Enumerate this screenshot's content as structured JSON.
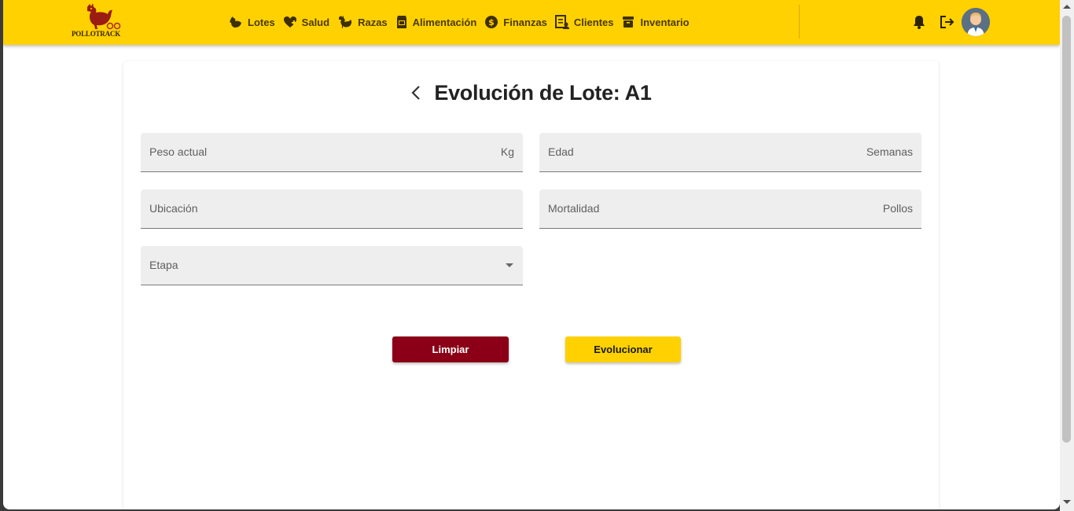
{
  "app": {
    "logo_text": "POLLOTRACK",
    "brand_color": "#ffd100",
    "accent_red": "#8b0016"
  },
  "nav": {
    "items": [
      {
        "label": "Lotes",
        "icon": "chicken-icon"
      },
      {
        "label": "Salud",
        "icon": "health-heart-icon"
      },
      {
        "label": "Razas",
        "icon": "rooster-icon"
      },
      {
        "label": "Alimentación",
        "icon": "feed-bag-icon"
      },
      {
        "label": "Finanzas",
        "icon": "dollar-icon"
      },
      {
        "label": "Clientes",
        "icon": "clients-list-icon"
      },
      {
        "label": "Inventario",
        "icon": "inventory-box-icon"
      }
    ]
  },
  "header_actions": {
    "notifications_icon": "bell-icon",
    "logout_icon": "logout-icon",
    "avatar_icon": "user-avatar"
  },
  "page": {
    "title": "Evolución de Lote: A1"
  },
  "form": {
    "peso": {
      "label": "Peso actual",
      "suffix": "Kg",
      "value": ""
    },
    "edad": {
      "label": "Edad",
      "suffix": "Semanas",
      "value": ""
    },
    "ubicacion": {
      "label": "Ubicación",
      "value": ""
    },
    "mortalidad": {
      "label": "Mortalidad",
      "suffix": "Pollos",
      "value": ""
    },
    "etapa": {
      "label": "Etapa",
      "value": ""
    }
  },
  "buttons": {
    "clear_label": "Limpiar",
    "evolve_label": "Evolucionar"
  }
}
